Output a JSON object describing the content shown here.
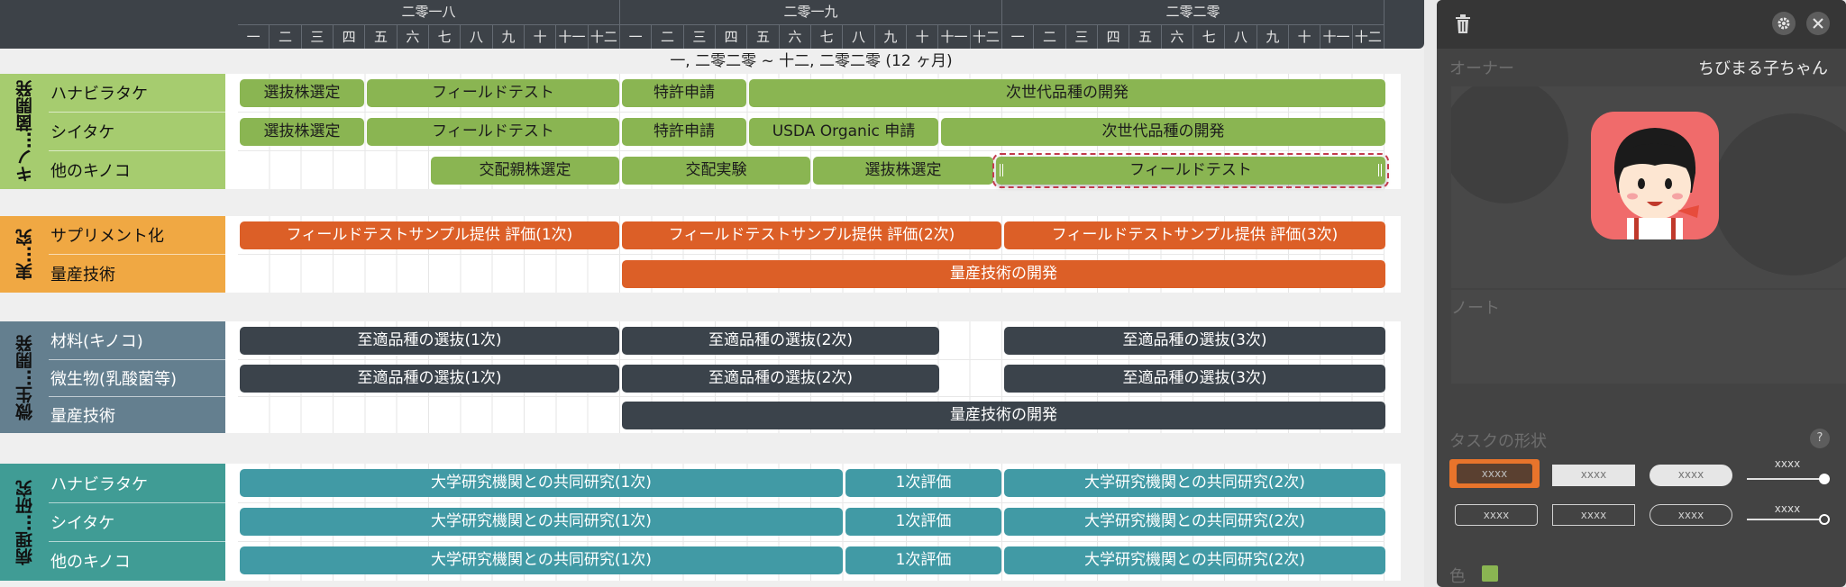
{
  "header": {
    "years": [
      "二零一八",
      "二零一九",
      "二零二零"
    ],
    "months": [
      "一",
      "二",
      "三",
      "四",
      "五",
      "六",
      "七",
      "八",
      "九",
      "十",
      "十一",
      "十二"
    ],
    "range_label": "一, 二零二零 ~ 十二, 二零二零 (12 ヶ月)"
  },
  "groups": [
    {
      "label": "キノ…菌開発",
      "color": "#a6cc6f",
      "rows": [
        "ハナビラタケ",
        "シイタケ",
        "他のキノコ"
      ]
    },
    {
      "label": "実…究",
      "color": "#f0a843",
      "rows": [
        "サプリメント化",
        "量産技術"
      ]
    },
    {
      "label": "微生…開発",
      "color": "#647f8f",
      "rows": [
        "材料(キノコ)",
        "微生物(乳酸菌等)",
        "量産技術"
      ]
    },
    {
      "label": "病理…研究",
      "color": "#409c95",
      "rows": [
        "ハナビラタケ",
        "シイタケ",
        "他のキノコ"
      ]
    }
  ],
  "tasks": {
    "g0r0": [
      "選抜株選定",
      "フィールドテスト",
      "特許申請",
      "次世代品種の開発"
    ],
    "g0r1": [
      "選抜株選定",
      "フィールドテスト",
      "特許申請",
      "USDA Organic 申請",
      "次世代品種の開発"
    ],
    "g0r2": [
      "交配親株選定",
      "交配実験",
      "選抜株選定",
      "フィールドテスト"
    ],
    "g1r0": [
      "フィールドテストサンプル提供 評価(1次)",
      "フィールドテストサンプル提供 評価(2次)",
      "フィールドテストサンプル提供 評価(3次)"
    ],
    "g1r1": [
      "量産技術の開発"
    ],
    "g2r0": [
      "至適品種の選抜(1次)",
      "至適品種の選抜(2次)",
      "至適品種の選抜(3次)"
    ],
    "g2r1": [
      "至適品種の選抜(1次)",
      "至適品種の選抜(2次)",
      "至適品種の選抜(3次)"
    ],
    "g2r2": [
      "量産技術の開発"
    ],
    "g3r0": [
      "大学研究機関との共同研究(1次)",
      "1次評価",
      "大学研究機関との共同研究(2次)"
    ],
    "g3r1": [
      "大学研究機関との共同研究(1次)",
      "1次評価",
      "大学研究機関との共同研究(2次)"
    ],
    "g3r2": [
      "大学研究機関との共同研究(1次)",
      "1次評価",
      "大学研究機関との共同研究(2次)"
    ]
  },
  "panel": {
    "owner_label": "オーナー",
    "owner_name": "ちびまる子ちゃん",
    "note_label": "ノート",
    "shape_label": "タスクの形状",
    "help": "?",
    "shape_sample": "xxxx",
    "color_label": "色",
    "selected_color": "#8ab552",
    "icons": [
      "trash-icon",
      "gear-icon",
      "close-icon"
    ]
  }
}
